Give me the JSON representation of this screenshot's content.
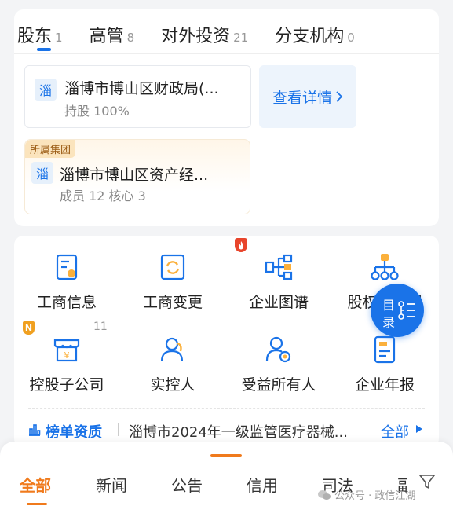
{
  "tabs": [
    {
      "label": "股东",
      "count": "1"
    },
    {
      "label": "高管",
      "count": "8"
    },
    {
      "label": "对外投资",
      "count": "21"
    },
    {
      "label": "分支机构",
      "count": "0"
    }
  ],
  "shareholder": {
    "logo_char": "淄",
    "name": "淄博市博山区财政局(...",
    "share": "持股 100%",
    "detail_label": "查看详情"
  },
  "group": {
    "tag": "所属集团",
    "logo_char": "淄",
    "name": "淄博市博山区资产经...",
    "members": "成员 12  核心 3"
  },
  "features": {
    "row1": [
      "工商信息",
      "工商变更",
      "企业图谱",
      "股权结构图"
    ],
    "row2": [
      "控股子公司",
      "实控人",
      "受益所有人",
      "企业年报"
    ],
    "badge_n": "N",
    "count_label": "11"
  },
  "toc": {
    "line1": "目",
    "line2": "录"
  },
  "ranking": {
    "title": "榜单资质",
    "text": "淄博市2024年一级监管医疗器械...",
    "all_label": "全部"
  },
  "bottom_tabs": [
    "全部",
    "新闻",
    "公告",
    "信用",
    "司法",
    "副"
  ],
  "watermark": "公众号 · 政信江湖",
  "colors": {
    "accent": "#1a73e8",
    "orange": "#f07a1c"
  }
}
